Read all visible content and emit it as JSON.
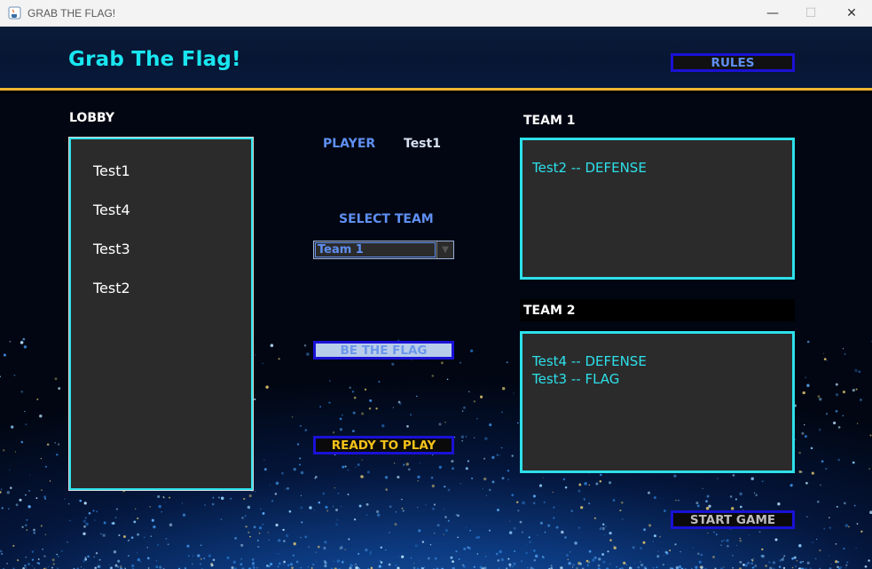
{
  "window": {
    "title": "GRAB THE FLAG!",
    "minimize": "—",
    "maximize": "☐",
    "close": "✕"
  },
  "header": {
    "title": "Grab The Flag!",
    "rules_label": "RULES"
  },
  "lobby": {
    "label": "LOBBY",
    "players": [
      "Test1",
      "Test4",
      "Test3",
      "Test2"
    ]
  },
  "player": {
    "label": "PLAYER",
    "name": "Test1"
  },
  "team_select": {
    "label": "SELECT TEAM",
    "selected": "Team 1"
  },
  "buttons": {
    "be_the_flag": "BE THE FLAG",
    "ready": "READY TO PLAY",
    "start": "START GAME"
  },
  "team1": {
    "label": "TEAM 1",
    "members": [
      "Test2 -- DEFENSE"
    ]
  },
  "team2": {
    "label": "TEAM 2",
    "members": [
      "Test4 -- DEFENSE",
      "Test3 -- FLAG"
    ]
  },
  "colors": {
    "accent_cyan": "#2de0ea",
    "button_border": "#1a11d6",
    "label_blue": "#5f8ff2",
    "gold": "#f6c21a",
    "header_rule": "#f2b632"
  }
}
